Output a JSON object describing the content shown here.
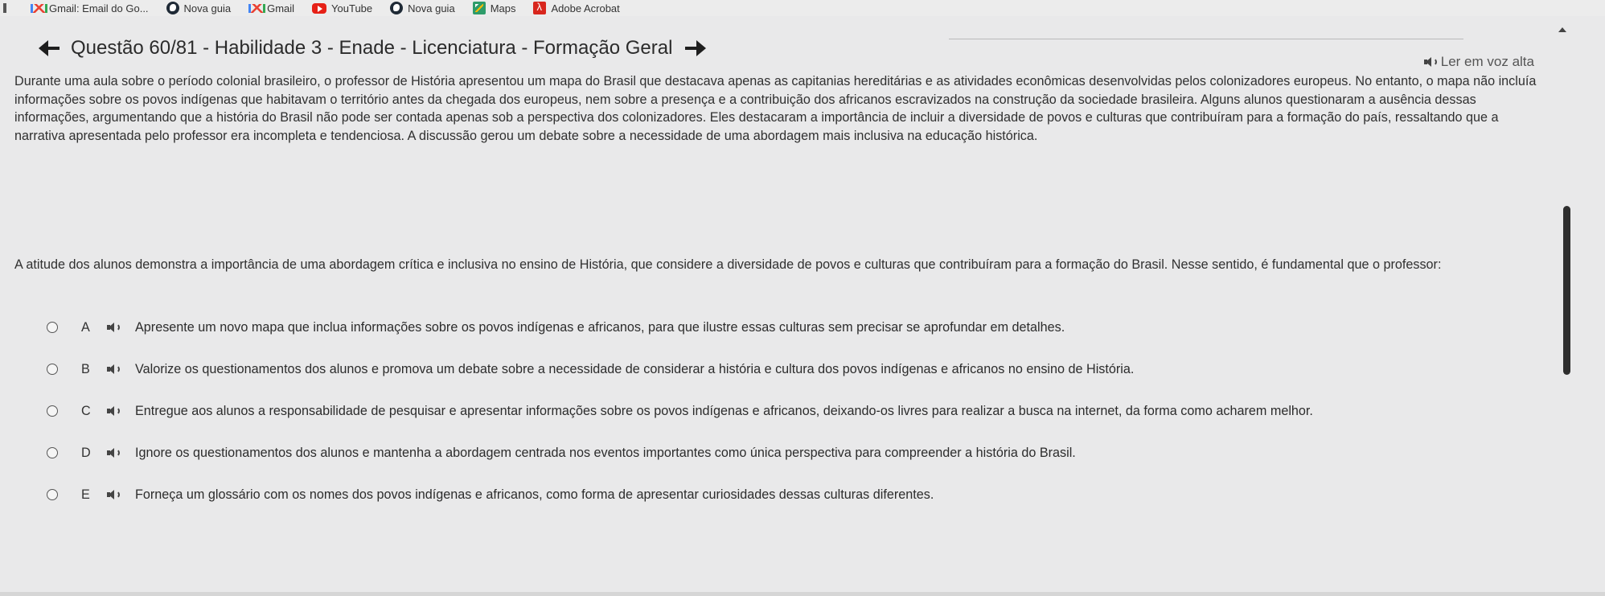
{
  "bookmarks": [
    {
      "label": "Gmail: Email do Go...",
      "icon": "gmail-icon"
    },
    {
      "label": "Nova guia",
      "icon": "globe-icon"
    },
    {
      "label": "Gmail",
      "icon": "gmail-icon"
    },
    {
      "label": "YouTube",
      "icon": "youtube-icon"
    },
    {
      "label": "Nova guia",
      "icon": "globe-icon"
    },
    {
      "label": "Maps",
      "icon": "maps-icon"
    },
    {
      "label": "Adobe Acrobat",
      "icon": "acrobat-icon"
    }
  ],
  "header": {
    "title": "Questão 60/81 - Habilidade 3 - Enade - Licenciatura - Formação Geral",
    "read_aloud": "Ler em voz alta"
  },
  "statement": "Durante uma aula sobre o período colonial brasileiro, o professor de História apresentou um mapa do Brasil que destacava apenas as capitanias hereditárias e as atividades econômicas desenvolvidas pelos colonizadores europeus. No entanto, o mapa não incluía informações sobre os povos indígenas que habitavam o território antes da chegada dos europeus, nem sobre a presença e a contribuição dos africanos escravizados na construção da sociedade brasileira. Alguns alunos questionaram a ausência dessas informações, argumentando que a história do Brasil não pode ser contada apenas sob a perspectiva dos colonizadores. Eles destacaram a importância de incluir a diversidade de povos e culturas que contribuíram para a formação do país, ressaltando que a narrativa apresentada pelo professor era incompleta e tendenciosa. A discussão gerou um debate sobre a necessidade de uma abordagem mais inclusiva na educação histórica.",
  "question": "A atitude dos alunos demonstra a importância de uma abordagem crítica e inclusiva no ensino de História, que considere a diversidade de povos e culturas que contribuíram para a formação do Brasil. Nesse sentido, é fundamental que o professor:",
  "options": [
    {
      "letter": "A",
      "text": "Apresente um novo mapa que inclua informações sobre os povos indígenas e africanos, para que ilustre essas culturas sem precisar se aprofundar em detalhes."
    },
    {
      "letter": "B",
      "text": "Valorize os questionamentos dos alunos e promova um debate sobre a necessidade de considerar a história e cultura dos povos indígenas e africanos no ensino de História."
    },
    {
      "letter": "C",
      "text": "Entregue aos alunos a responsabilidade de pesquisar e apresentar informações sobre os povos indígenas e africanos, deixando-os livres para realizar a busca na internet, da forma como acharem melhor."
    },
    {
      "letter": "D",
      "text": "Ignore os questionamentos dos alunos e mantenha a abordagem centrada nos eventos importantes como única perspectiva para compreender a história do Brasil."
    },
    {
      "letter": "E",
      "text": "Forneça um glossário com os nomes dos povos indígenas e africanos, como forma de apresentar curiosidades dessas culturas diferentes."
    }
  ]
}
